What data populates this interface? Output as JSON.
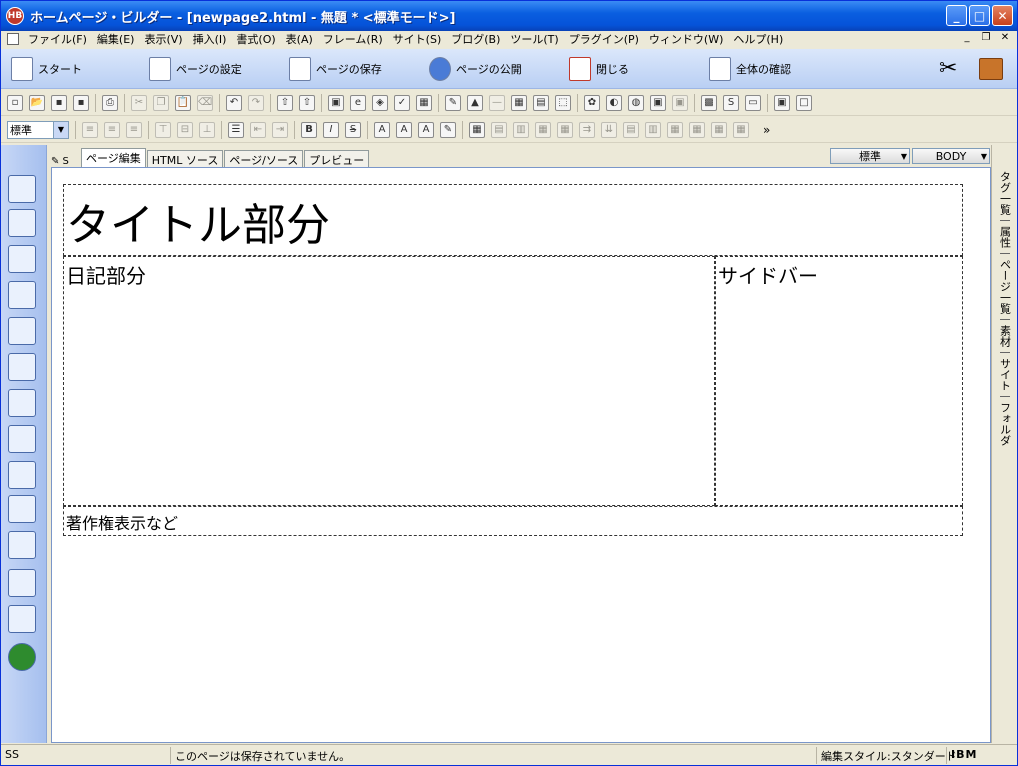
{
  "window": {
    "title": "ホームページ・ビルダー - [newpage2.html - 無題 * <標準モード>]",
    "app_icon": "builder-logo-icon"
  },
  "menu": [
    "ファイル(F)",
    "編集(E)",
    "表示(V)",
    "挿入(I)",
    "書式(O)",
    "表(A)",
    "フレーム(R)",
    "サイト(S)",
    "ブログ(B)",
    "ツール(T)",
    "プラグイン(P)",
    "ウィンドウ(W)",
    "ヘルプ(H)"
  ],
  "bigbar": {
    "start": "スタート",
    "page_settings": "ページの設定",
    "save_page": "ページの保存",
    "publish_page": "ページの公開",
    "close": "閉じる",
    "check_all": "全体の確認"
  },
  "format": {
    "style": "標準"
  },
  "tabs": [
    "ページ編集",
    "HTML ソース",
    "ページ/ソース",
    "プレビュー"
  ],
  "combos": {
    "mode": "標準",
    "element": "BODY"
  },
  "canvas": {
    "title_region": "タイトル部分",
    "diary_region": "日記部分",
    "sidebar_region": "サイドバー",
    "footer_region": "著作権表示など"
  },
  "right_tabs": [
    "タグ一覧",
    "属性",
    "ページ一覧",
    "素材",
    "サイト",
    "フォルダ"
  ],
  "status": {
    "ss": "SS",
    "message": "このページは保存されていません。",
    "edit_style": "編集スタイル:スタンダード",
    "brand": "IBM"
  }
}
